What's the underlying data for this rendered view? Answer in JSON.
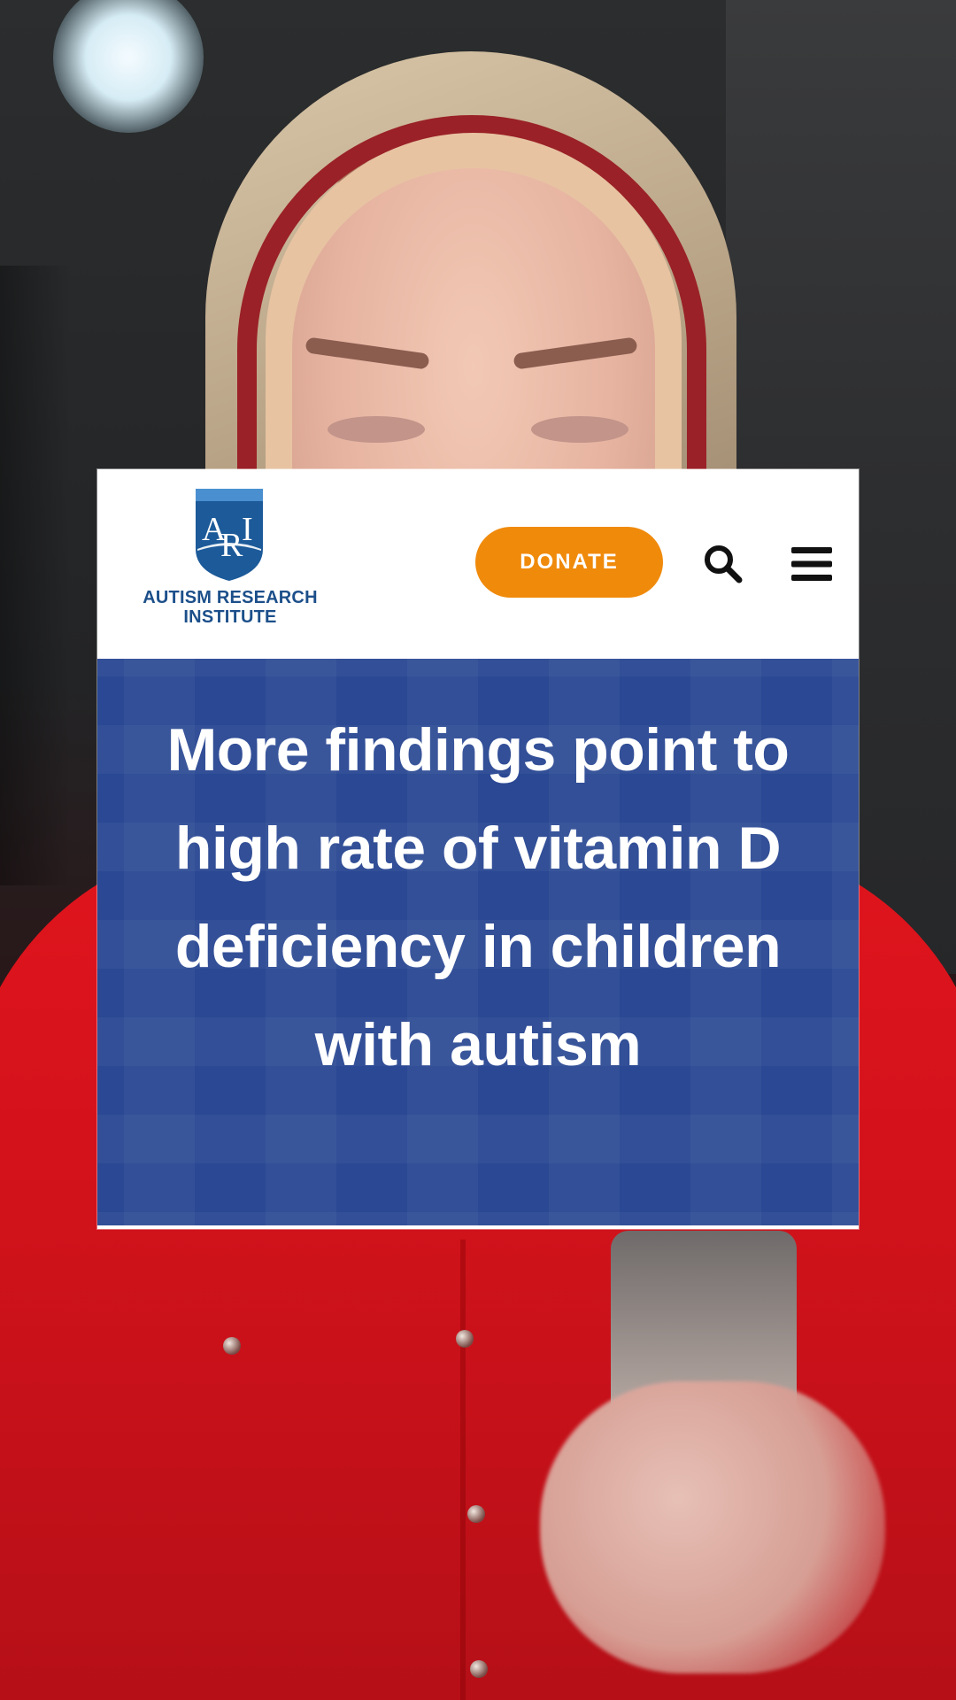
{
  "overlay": {
    "logo": {
      "monogram": "ARI",
      "line1": "AUTISM RESEARCH",
      "line2": "INSTITUTE"
    },
    "header": {
      "donate_label": "DONATE",
      "search_icon": "search-icon",
      "menu_icon": "hamburger-menu-icon"
    },
    "headline": "More findings point to high rate of vitamin D deficiency in children with autism"
  },
  "colors": {
    "brand_blue": "#1c4f8a",
    "hero_blue": "#2a4893",
    "donate_orange": "#f08a0b"
  }
}
